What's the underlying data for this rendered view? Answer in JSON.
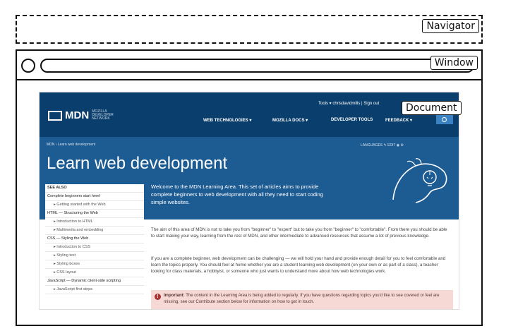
{
  "labels": {
    "navigator": "Navigator",
    "window": "Window",
    "document": "Document"
  },
  "page": {
    "top_links": "Tools  ▾    chrisdavidmills  |  Sign out",
    "logo_word": "MDN",
    "logo_small": "MOZILLA DEVELOPER NETWORK",
    "menu": [
      "WEB TECHNOLOGIES  ▾",
      "MOZILLA DOCS  ▾",
      "DEVELOPER TOOLS",
      "FEEDBACK  ▾"
    ],
    "breadcrumb": "MDN  ›  Learn web development",
    "tools_row": "LANGUAGES   ✎ EDIT   ◉   ⚙",
    "title": "Learn web development",
    "welcome": "Welcome to the MDN Learning Area. This set of articles aims to provide complete beginners to web development with all they need to start coding simple websites.",
    "sidebar": [
      "SEE ALSO",
      "Complete beginners start here!",
      "▸  Getting started with the Web",
      "HTML — Structuring the Web",
      "▸  Introduction to HTML",
      "▸  Multimedia and embedding",
      "CSS — Styling the Web",
      "▸  Introduction to CSS",
      "▸  Styling text",
      "▸  Styling boxes",
      "▸  CSS layout",
      "JavaScript — Dynamic client-side scripting",
      "▸  JavaScript first steps"
    ],
    "para1": "The aim of this area of MDN is not to take you from \"beginner\" to \"expert\" but to take you from \"beginner\" to \"comfortable\". From there you should be able to start making your way, learning from the rest of MDN, and other intermediate to advanced resources that assume a lot of previous knowledge.",
    "para2": "If you are a complete beginner, web development can be challenging — we will hold your hand and provide enough detail for you to feel comfortable and learn the topics properly. You should feel at home whether you are a student learning web development (on your own or as part of a class), a teacher looking for class materials, a hobbyist, or someone who just wants to understand more about how web technologies work.",
    "alert_label": "Important:",
    "alert_text": "The content in the Learning Area is being added to regularly. If you have questions regarding topics you'd like to see covered or feel are missing, see our Contribute section below for information on how to get in touch."
  }
}
